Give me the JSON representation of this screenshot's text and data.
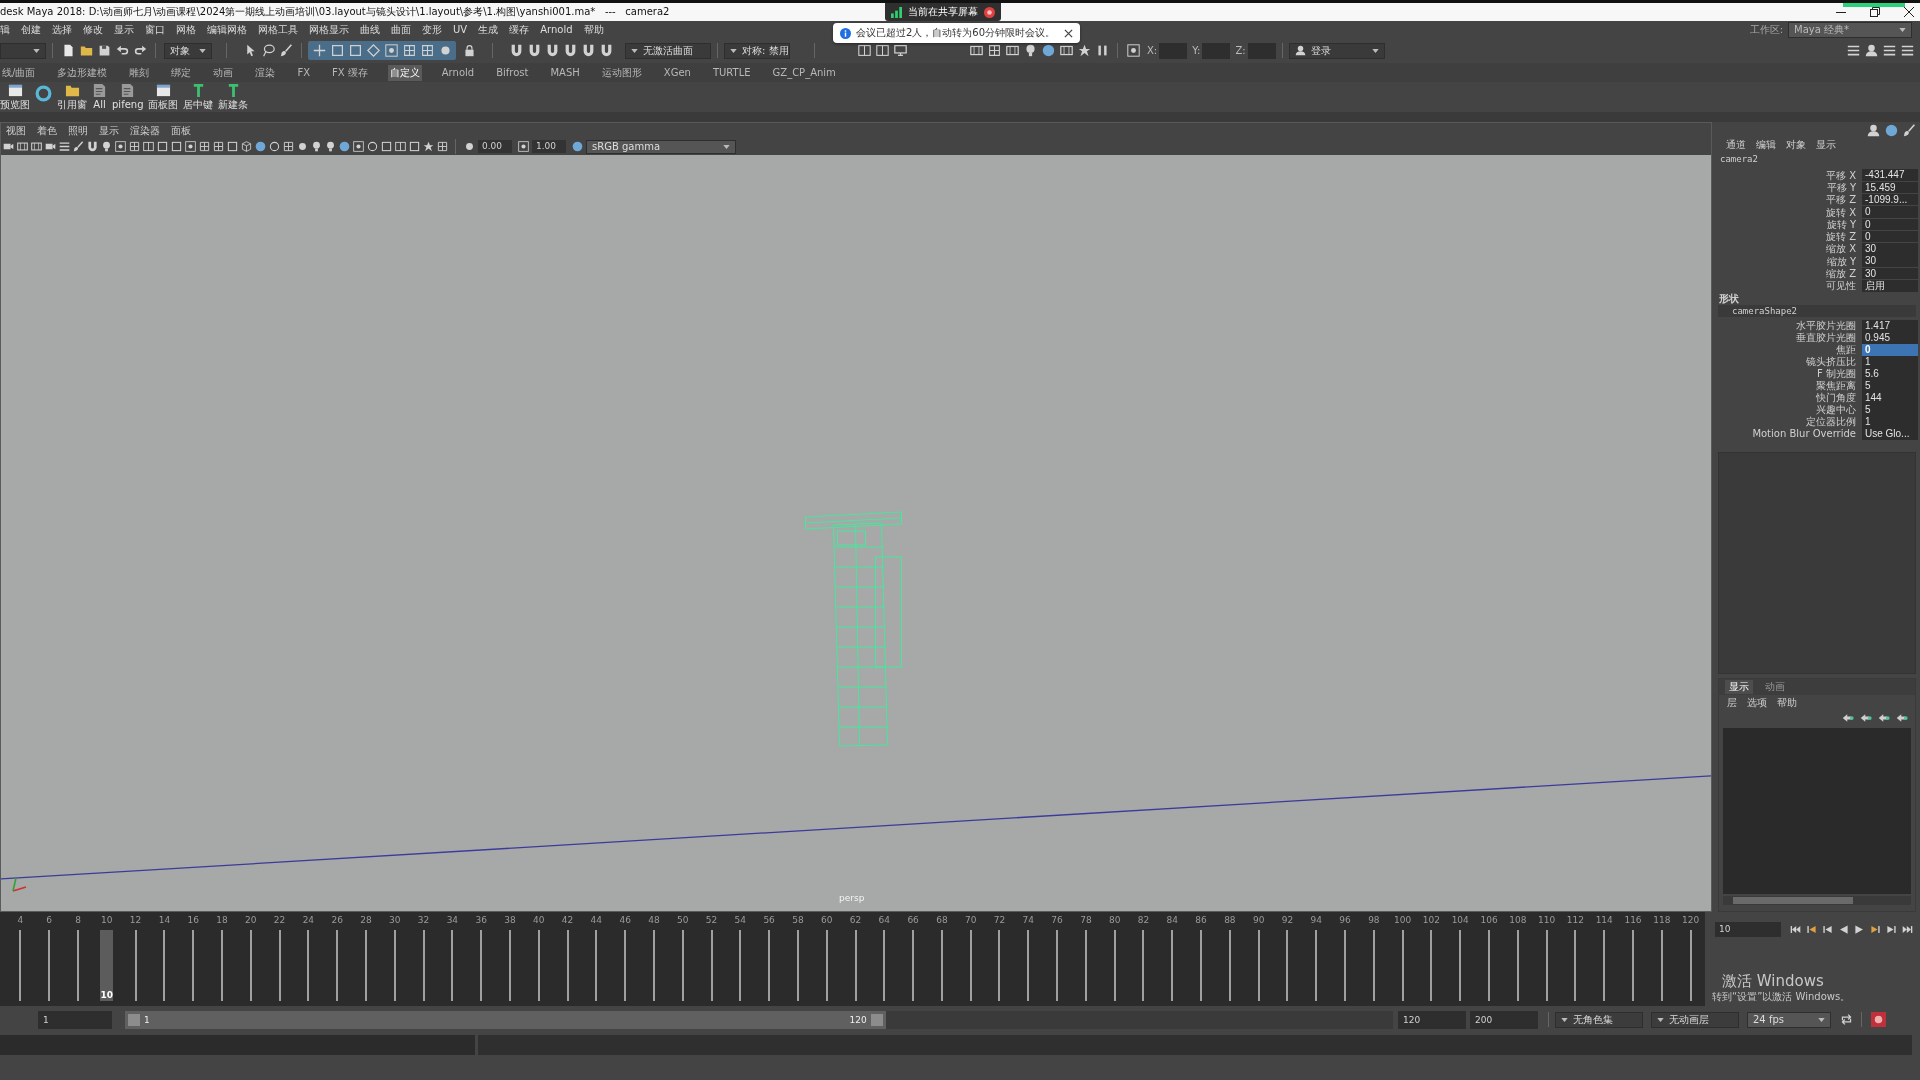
{
  "title_bar": {
    "title": "desk Maya 2018: D:\\动画师七月\\动画课程\\2024第一期线上动画培训\\03.layout与镜头设计\\1.layout\\参考\\1.构图\\yanshi001.ma*   ---   camera2"
  },
  "screen_share": {
    "text": "当前在共享屏幕"
  },
  "notification": {
    "text": "会议已超过2人，自动转为60分钟限时会议。"
  },
  "menu_bar": {
    "items": [
      "辑",
      "创建",
      "选择",
      "修改",
      "显示",
      "窗口",
      "网格",
      "编辑网格",
      "网格工具",
      "网格显示",
      "曲线",
      "曲面",
      "变形",
      "UV",
      "生成",
      "缓存",
      "Arnold",
      "帮助"
    ],
    "workspace_label": "工作区:",
    "workspace": "Maya 经典*"
  },
  "status_line": {
    "selection_mode": "对象",
    "live_surface": "无激活曲面",
    "symmetry": "对称: 禁用",
    "coordinates": [
      "X:",
      "Y:",
      "Z:"
    ],
    "login": "登录"
  },
  "shelf": {
    "tabs": [
      {
        "label": "线/曲面",
        "selected": false
      },
      {
        "label": "多边形建模",
        "selected": false
      },
      {
        "label": "雕刻",
        "selected": false
      },
      {
        "label": "绑定",
        "selected": false
      },
      {
        "label": "动画",
        "selected": false
      },
      {
        "label": "渲染",
        "selected": false
      },
      {
        "label": "FX",
        "selected": false
      },
      {
        "label": "FX 缓存",
        "selected": false
      },
      {
        "label": "自定义",
        "selected": true
      },
      {
        "label": "Arnold",
        "selected": false
      },
      {
        "label": "Bifrost",
        "selected": false
      },
      {
        "label": "MASH",
        "selected": false
      },
      {
        "label": "运动图形",
        "selected": false
      },
      {
        "label": "XGen",
        "selected": false
      },
      {
        "label": "TURTLE",
        "selected": false
      },
      {
        "label": "GZ_CP_Anim",
        "selected": false
      }
    ],
    "buttons": [
      {
        "kind": "image",
        "label": "预览图"
      },
      {
        "kind": "ring"
      },
      {
        "kind": "folder",
        "label": "引用窗"
      },
      {
        "kind": "script",
        "label": "All"
      },
      {
        "kind": "script",
        "label": "pifeng"
      },
      {
        "kind": "image",
        "label": "面板图"
      },
      {
        "kind": "pin",
        "label": "居中键"
      },
      {
        "kind": "pin",
        "label": "新建条"
      }
    ]
  },
  "viewport": {
    "menu": [
      "视图",
      "着色",
      "照明",
      "显示",
      "渲染器",
      "面板"
    ],
    "exposure": "0.00",
    "gamma": "1.00",
    "color_space": "sRGB gamma",
    "camera": "persp"
  },
  "channel_box": {
    "tabs": [
      "通道",
      "编辑",
      "对象",
      "显示"
    ],
    "node": "camera2",
    "channels": [
      {
        "name": "平移 X",
        "value": "-431.447",
        "selected": false
      },
      {
        "name": "平移 Y",
        "value": "15.459",
        "selected": false
      },
      {
        "name": "平移 Z",
        "value": "-1099.9...",
        "selected": false
      },
      {
        "name": "旋转 X",
        "value": "0",
        "selected": false
      },
      {
        "name": "旋转 Y",
        "value": "0",
        "selected": false
      },
      {
        "name": "旋转 Z",
        "value": "0",
        "selected": false
      },
      {
        "name": "缩放 X",
        "value": "30",
        "selected": false
      },
      {
        "name": "缩放 Y",
        "value": "30",
        "selected": false
      },
      {
        "name": "缩放 Z",
        "value": "30",
        "selected": false
      },
      {
        "name": "可见性",
        "value": "启用",
        "selected": false
      }
    ],
    "shape_heading": "形状",
    "shape_node": "cameraShape2",
    "shape_channels": [
      {
        "name": "水平胶片光圈",
        "value": "1.417",
        "selected": false
      },
      {
        "name": "垂直胶片光圈",
        "value": "0.945",
        "selected": false
      },
      {
        "name": "焦距",
        "value": "0",
        "selected": true
      },
      {
        "name": "镜头挤压比",
        "value": "1",
        "selected": false
      },
      {
        "name": "F 制光圈",
        "value": "5.6",
        "selected": false
      },
      {
        "name": "聚焦距离",
        "value": "5",
        "selected": false
      },
      {
        "name": "快门角度",
        "value": "144",
        "selected": false
      },
      {
        "name": "兴趣中心",
        "value": "5",
        "selected": false
      },
      {
        "name": "定位器比例",
        "value": "1",
        "selected": false
      },
      {
        "name": "Motion Blur Override",
        "value": "Use Glo...",
        "selected": false
      }
    ]
  },
  "layer_editor": {
    "tabs": [
      {
        "label": "显示",
        "selected": true
      },
      {
        "label": "动画",
        "selected": false
      }
    ],
    "menu": [
      "层",
      "选项",
      "帮助"
    ]
  },
  "time_slider": {
    "ticks": [
      {
        "label": "4",
        "selected": false
      },
      {
        "label": "6",
        "selected": false
      },
      {
        "label": "8",
        "selected": false
      },
      {
        "label": "10",
        "selected": true
      },
      {
        "label": "12",
        "selected": false
      },
      {
        "label": "14",
        "selected": false
      },
      {
        "label": "16",
        "selected": false
      },
      {
        "label": "18",
        "selected": false
      },
      {
        "label": "20",
        "selected": false
      },
      {
        "label": "22",
        "selected": false
      },
      {
        "label": "24",
        "selected": false
      },
      {
        "label": "26",
        "selected": false
      },
      {
        "label": "28",
        "selected": false
      },
      {
        "label": "30",
        "selected": false
      },
      {
        "label": "32",
        "selected": false
      },
      {
        "label": "34",
        "selected": false
      },
      {
        "label": "36",
        "selected": false
      },
      {
        "label": "38",
        "selected": false
      },
      {
        "label": "40",
        "selected": false
      },
      {
        "label": "42",
        "selected": false
      },
      {
        "label": "44",
        "selected": false
      },
      {
        "label": "46",
        "selected": false
      },
      {
        "label": "48",
        "selected": false
      },
      {
        "label": "50",
        "selected": false
      },
      {
        "label": "52",
        "selected": false
      },
      {
        "label": "54",
        "selected": false
      },
      {
        "label": "56",
        "selected": false
      },
      {
        "label": "58",
        "selected": false
      },
      {
        "label": "60",
        "selected": false
      },
      {
        "label": "62",
        "selected": false
      },
      {
        "label": "64",
        "selected": false
      },
      {
        "label": "66",
        "selected": false
      },
      {
        "label": "68",
        "selected": false
      },
      {
        "label": "70",
        "selected": false
      },
      {
        "label": "72",
        "selected": false
      },
      {
        "label": "74",
        "selected": false
      },
      {
        "label": "76",
        "selected": false
      },
      {
        "label": "78",
        "selected": false
      },
      {
        "label": "80",
        "selected": false
      },
      {
        "label": "82",
        "selected": false
      },
      {
        "label": "84",
        "selected": false
      },
      {
        "label": "86",
        "selected": false
      },
      {
        "label": "88",
        "selected": false
      },
      {
        "label": "90",
        "selected": false
      },
      {
        "label": "92",
        "selected": false
      },
      {
        "label": "94",
        "selected": false
      },
      {
        "label": "96",
        "selected": false
      },
      {
        "label": "98",
        "selected": false
      },
      {
        "label": "100",
        "selected": false
      },
      {
        "label": "102",
        "selected": false
      },
      {
        "label": "104",
        "selected": false
      },
      {
        "label": "106",
        "selected": false
      },
      {
        "label": "108",
        "selected": false
      },
      {
        "label": "110",
        "selected": false
      },
      {
        "label": "112",
        "selected": false
      },
      {
        "label": "114",
        "selected": false
      },
      {
        "label": "116",
        "selected": false
      },
      {
        "label": "118",
        "selected": false
      },
      {
        "label": "120",
        "selected": false
      }
    ],
    "current_frame": "10",
    "frame_field": "10"
  },
  "range_slider": {
    "start": "1",
    "range_start": "1",
    "range_end": "120",
    "level": 0.6,
    "end": "120",
    "max_end": "200",
    "character_set": "无角色集",
    "animation_layer": "无动画层",
    "fps": "24 fps"
  },
  "activation_notice": {
    "title": "激活 Windows",
    "text": "转到“设置”以激活 Windows。"
  }
}
